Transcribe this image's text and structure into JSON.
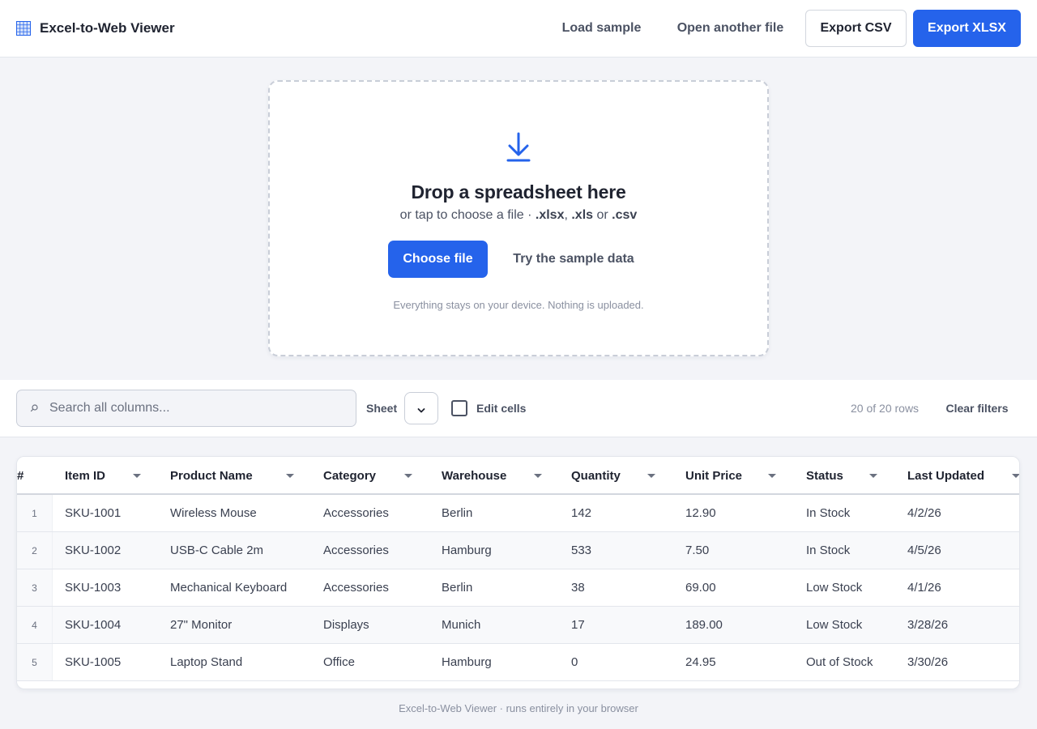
{
  "header": {
    "title": "Excel-to-Web Viewer",
    "icon": "spreadsheet-grid-icon",
    "load_sample": "Load sample",
    "open_another": "Open another file",
    "export_csv": "Export CSV",
    "export_xlsx": "Export XLSX"
  },
  "dropzone": {
    "icon": "download-arrow-icon",
    "title": "Drop a spreadsheet here",
    "subtitle_prefix": "or tap to choose a file · ",
    "ext1": ".xlsx",
    "sep1": ", ",
    "ext2": ".xls",
    "sep2": " or ",
    "ext3": ".csv",
    "choose_label": "Choose file",
    "try_label": "Try the sample data",
    "note": "Everything stays on your device. Nothing is uploaded."
  },
  "toolbar": {
    "search_placeholder": "Search all columns...",
    "search_value": "",
    "sheet_label": "Sheet",
    "sheet_value": "",
    "edit_label": "Edit cells",
    "edit_checked": false,
    "row_count": "20 of 20 rows",
    "clear_filters": "Clear filters"
  },
  "table": {
    "index_header": "#",
    "columns": [
      "Item ID",
      "Product Name",
      "Category",
      "Warehouse",
      "Quantity",
      "Unit Price",
      "Status",
      "Last Updated"
    ],
    "rows": [
      {
        "index": "1",
        "cells": [
          "SKU-1001",
          "Wireless Mouse",
          "Accessories",
          "Berlin",
          "142",
          "12.90",
          "In Stock",
          "4/2/26"
        ]
      },
      {
        "index": "2",
        "cells": [
          "SKU-1002",
          "USB-C Cable 2m",
          "Accessories",
          "Hamburg",
          "533",
          "7.50",
          "In Stock",
          "4/5/26"
        ]
      },
      {
        "index": "3",
        "cells": [
          "SKU-1003",
          "Mechanical Keyboard",
          "Accessories",
          "Berlin",
          "38",
          "69.00",
          "Low Stock",
          "4/1/26"
        ]
      },
      {
        "index": "4",
        "cells": [
          "SKU-1004",
          "27\" Monitor",
          "Displays",
          "Munich",
          "17",
          "189.00",
          "Low Stock",
          "3/28/26"
        ]
      },
      {
        "index": "5",
        "cells": [
          "SKU-1005",
          "Laptop Stand",
          "Office",
          "Hamburg",
          "0",
          "24.95",
          "Out of Stock",
          "3/30/26"
        ]
      }
    ]
  },
  "footer": {
    "text": "Excel-to-Web Viewer · runs entirely in your browser"
  },
  "colors": {
    "accent": "#2563eb",
    "background": "#f3f4f8",
    "text": "#1f2330",
    "muted": "#8a90a0"
  }
}
